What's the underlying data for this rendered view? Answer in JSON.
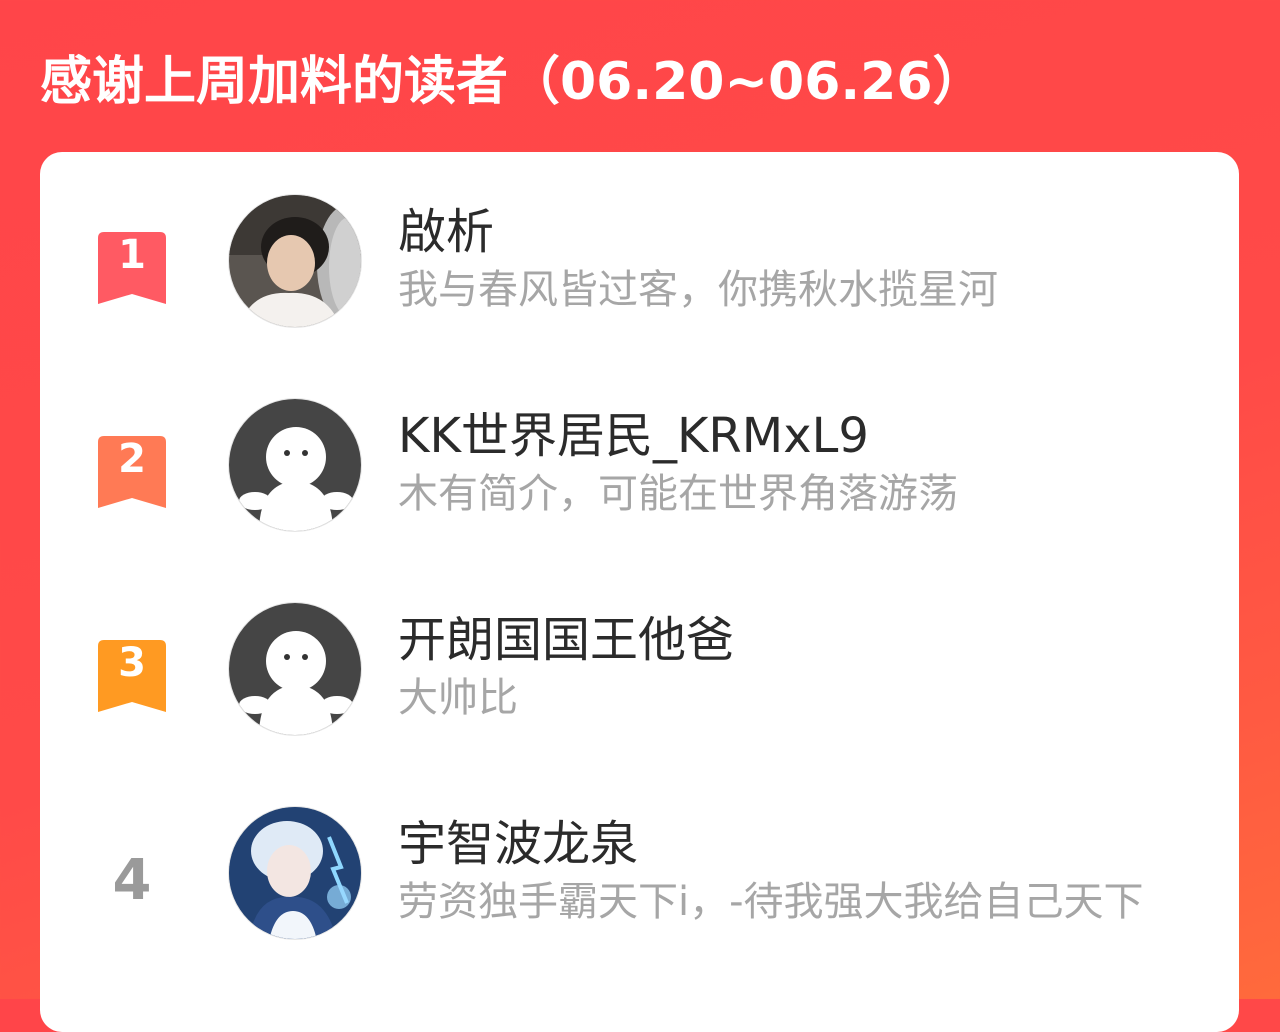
{
  "header": {
    "title": "感谢上周加料的读者（06.20~06.26）"
  },
  "colors": {
    "background": "#ff4549",
    "rank1": "#ff5a63",
    "rank2": "#ff7a55",
    "rank3": "#ff9a22",
    "rank_plain": "#9a9a9a",
    "name_text": "#2b2b2b",
    "bio_text": "#a6a6a6"
  },
  "readers": [
    {
      "rank": "1",
      "name": "啟析",
      "bio": "我与春风皆过客，你携秋水揽星河",
      "avatar": "photo-avatar"
    },
    {
      "rank": "2",
      "name": "KK世界居民_KRMxL9",
      "bio": "木有简介，可能在世界角落游荡",
      "avatar": "default-avatar"
    },
    {
      "rank": "3",
      "name": "开朗国国王他爸",
      "bio": "大帅比",
      "avatar": "default-avatar"
    },
    {
      "rank": "4",
      "name": "宇智波龙泉",
      "bio": "劳资独手霸天下i，-待我强大我给自己天下",
      "avatar": "anime-avatar"
    }
  ]
}
